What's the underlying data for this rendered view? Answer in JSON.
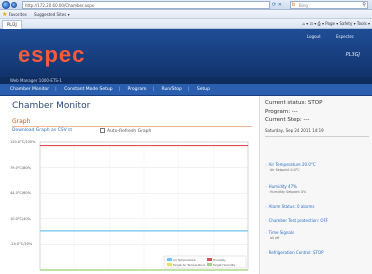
{
  "browser": {
    "url": "http://172.20.60.00/Chamber.aspx",
    "search_placeholder": "Bing",
    "favorites": [
      {
        "label": "Favorites"
      },
      {
        "label": "Suggested Sites ▾"
      }
    ],
    "tab_title": "PL/2J",
    "command_bar": "Page ▾  Safety ▾  Tools ▾"
  },
  "header": {
    "logo": "espec",
    "logout": "Logout",
    "espectec": "Espectec",
    "device_name": "PL3GJ",
    "subbar": "Web Manager 1000-ETS-1"
  },
  "nav": {
    "items": [
      "Chamber Monitor",
      "Constant Mode Setup",
      "Program",
      "Run/Stop",
      "Setup"
    ]
  },
  "main": {
    "title": "Chamber Monitor",
    "graph_heading": "Graph",
    "download_link": "Download Graph as CSV",
    "auto_refresh_label": "Auto-Refresh Graph"
  },
  "status": {
    "current_status": "Current status: STOP",
    "program": "Program: ---",
    "current_step": "Current Step: ---",
    "datetime": "Saturday, Sep 24 2011 14:19",
    "items": [
      {
        "icon": "thermometer-icon",
        "label": "Air Temperature 20.0°C",
        "sub": "Air Setpoint 0.0°C"
      },
      {
        "icon": "droplet-icon",
        "label": "Humidity 47%",
        "sub": "Humidity Setpoint 0%"
      },
      {
        "icon": "alarm-icon",
        "label": "Alarm Status: 0 alarms",
        "sub": ""
      },
      {
        "icon": "shield-icon",
        "label": "Chamber Test protection: OFF",
        "sub": ""
      },
      {
        "icon": "signal-icon",
        "label": "Time Signals",
        "sub": "all off"
      },
      {
        "icon": "refrigeration-icon",
        "label": "Refrigeration Control: STOP",
        "sub": ""
      }
    ]
  },
  "colors": {
    "header_bg": "#173f80",
    "logo": "#ff5a3c",
    "nav_bg": "#2a5fb0",
    "link": "#2a6ec4",
    "series_red": "#e0505a",
    "series_blue": "#6fc3ee",
    "series_yellow": "#e6e06a",
    "series_green": "#9fd48a"
  },
  "chart_data": {
    "type": "line",
    "y_tick_labels": [
      "120.0°C/100%",
      "79.0°C/80%",
      "44.0°C/60%",
      "10.0°C/40%",
      "-24.0°C/20%"
    ],
    "ylim": [
      -24,
      120
    ],
    "series": [
      {
        "name": "Air Temperature",
        "color": "#6fc3ee",
        "values": [
          20,
          20
        ]
      },
      {
        "name": "Humidity",
        "color": "#e0505a",
        "values": [
          116,
          116
        ]
      },
      {
        "name": "Target Air Temperature",
        "color": "#e6e06a",
        "values": [
          -24,
          -24
        ]
      },
      {
        "name": "Target Humidity",
        "color": "#9fd48a",
        "values": [
          -24,
          -24
        ]
      }
    ],
    "grid": true,
    "legend": "bottom-right"
  }
}
